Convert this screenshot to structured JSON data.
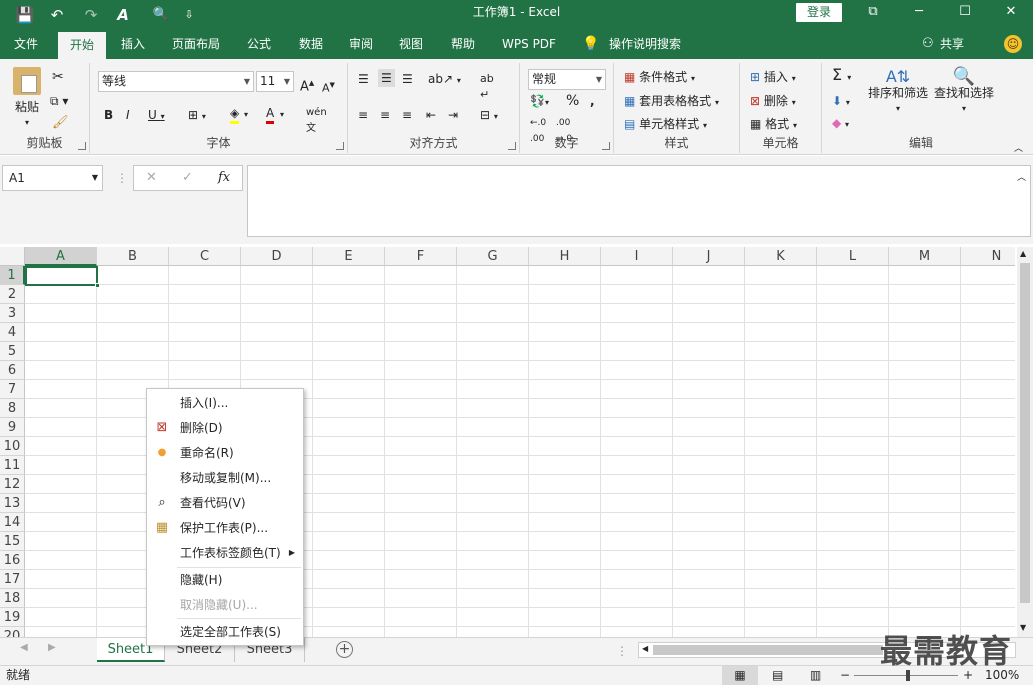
{
  "titlebar": {
    "title": "工作簿1  -  Excel",
    "login": "登录",
    "qa_save": "💾",
    "qa_undo": "↶",
    "qa_redo": "↷",
    "qa_format": "A",
    "qa_preview": "🔍",
    "qa_more": "⇩",
    "win_restore": "⧉",
    "win_min": "─",
    "win_max": "☐",
    "win_close": "✕"
  },
  "tabs": [
    {
      "label": "文件"
    },
    {
      "label": "开始"
    },
    {
      "label": "插入"
    },
    {
      "label": "页面布局"
    },
    {
      "label": "公式"
    },
    {
      "label": "数据"
    },
    {
      "label": "审阅"
    },
    {
      "label": "视图"
    },
    {
      "label": "帮助"
    },
    {
      "label": "WPS PDF"
    },
    {
      "label": "操作说明搜索"
    }
  ],
  "share": "共享",
  "ribbon": {
    "clipboard": {
      "label": "剪贴板",
      "paste": "粘贴"
    },
    "font": {
      "label": "字体",
      "name": "等线",
      "size": "11"
    },
    "alignment": {
      "label": "对齐方式"
    },
    "number": {
      "label": "数字",
      "format": "常规"
    },
    "styles": {
      "label": "样式",
      "cond": "条件格式",
      "table": "套用表格格式",
      "cell": "单元格样式"
    },
    "cells": {
      "label": "单元格",
      "insert": "插入",
      "delete": "删除",
      "format": "格式"
    },
    "editing": {
      "label": "编辑",
      "sort": "排序和筛选",
      "find": "查找和选择"
    }
  },
  "formula": {
    "namebox": "A1",
    "fx": "fx"
  },
  "columns": [
    "A",
    "B",
    "C",
    "D",
    "E",
    "F",
    "G",
    "H",
    "I",
    "J",
    "K",
    "L",
    "M",
    "N"
  ],
  "rows": [
    "1",
    "2",
    "3",
    "4",
    "5",
    "6",
    "7",
    "8",
    "9",
    "10",
    "11",
    "12",
    "13",
    "14",
    "15",
    "16",
    "17",
    "18",
    "19",
    "20"
  ],
  "context_menu": [
    {
      "label": "插入(I)...",
      "icon": "",
      "disabled": false
    },
    {
      "label": "删除(D)",
      "icon": "delete-sheet-icon",
      "disabled": false
    },
    {
      "label": "重命名(R)",
      "icon": "bullet-icon",
      "disabled": false
    },
    {
      "label": "移动或复制(M)...",
      "icon": "",
      "disabled": false
    },
    {
      "label": "查看代码(V)",
      "icon": "view-code-icon",
      "disabled": false
    },
    {
      "label": "保护工作表(P)...",
      "icon": "protect-sheet-icon",
      "disabled": false
    },
    {
      "label": "工作表标签颜色(T)",
      "icon": "",
      "disabled": false
    },
    {
      "label": "隐藏(H)",
      "icon": "",
      "disabled": false
    },
    {
      "label": "取消隐藏(U)...",
      "icon": "",
      "disabled": true
    },
    {
      "label": "选定全部工作表(S)",
      "icon": "",
      "disabled": false
    }
  ],
  "sheets": [
    {
      "label": "Sheet1"
    },
    {
      "label": "Sheet2"
    },
    {
      "label": "Sheet3"
    }
  ],
  "status": {
    "ready": "就绪",
    "zoom": "100%"
  },
  "watermark": "最需教育",
  "colors": {
    "accent": "#217346"
  }
}
